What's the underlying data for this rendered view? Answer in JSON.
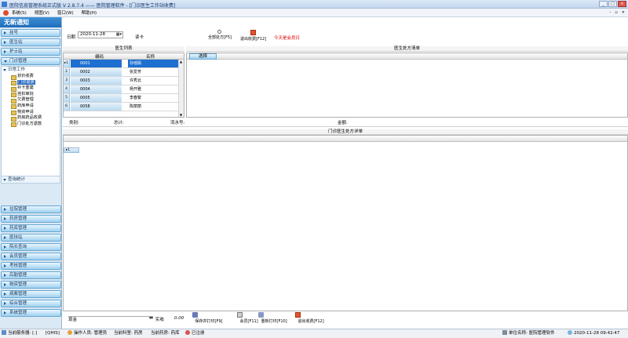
{
  "window": {
    "title": "医院信息管理系统正式版 V 2.8.7.4 —— 医院管理软件 - [门诊医生工作站收费]",
    "btn_min": "_",
    "btn_max": "□",
    "btn_close": "×"
  },
  "menu": {
    "items": [
      "系统(S)",
      "视图(V)",
      "窗口(W)",
      "帮助(H)"
    ],
    "right": [
      "-",
      "▫",
      "×"
    ]
  },
  "sidebar": {
    "notice": "无新通知",
    "top_groups": [
      "挂号",
      "医生站",
      "护士站"
    ],
    "open_group": "门诊管理",
    "sub_title": "日常工作",
    "tree": [
      "划价收费",
      "门诊退费",
      "补卡重建",
      "挂扣审批",
      "欠费管理",
      "药库申请",
      "物资申请",
      "药房药品收费",
      "门诊处方退款"
    ],
    "selected_index": 1,
    "stats": "查询统计",
    "bottom_groups": [
      "住院管理",
      "药房管理",
      "药库管理",
      "医技站",
      "院长查询",
      "会员管理",
      "考核管理",
      "后勤管理",
      "物资管理",
      "病案管理",
      "综合管理",
      "系统管理"
    ]
  },
  "toolbar": {
    "date_label": "日期",
    "date_value": "2020-11-28",
    "card_label": "读卡",
    "btn_all_rx": "全部处方[F5]",
    "btn_exit_charge": "退出收费[F12]",
    "today_notice": "今天是会员日"
  },
  "doctor_list": {
    "title": "医生列表",
    "col_code": "编码",
    "col_name": "名称",
    "rows": [
      {
        "n": "1",
        "code": "0001",
        "name": "孙瑶娟"
      },
      {
        "n": "2",
        "code": "0002",
        "name": "张爱芳"
      },
      {
        "n": "3",
        "code": "0003",
        "name": "许秀云"
      },
      {
        "n": "4",
        "code": "0004",
        "name": "杨开雅"
      },
      {
        "n": "5",
        "code": "0005",
        "name": "李春繁"
      },
      {
        "n": "6",
        "code": "0058",
        "name": "陈丽丽"
      }
    ],
    "selected_index": 0,
    "arrow": "▸"
  },
  "prescription": {
    "title": "医生处方清单",
    "select_btn": "选择"
  },
  "info": {
    "category": "类别:",
    "total": "总计:",
    "serial": "流水号:",
    "amount": "金额:"
  },
  "detail": {
    "title": "门诊医生处方详单",
    "row_marker": "▸1"
  },
  "bottom": {
    "label_left": "现金",
    "received_label": "实收",
    "received_value": "0.00",
    "btn_save_print": "保存并打印[F9]",
    "btn_membership": "会员[F11]",
    "btn_reprint": "重新打印[F10]",
    "btn_exit": "退出收费[F12]"
  },
  "status": {
    "service": "当前服务器: [.]",
    "db": "[QHIS]",
    "operator": "操作人员: 管理员",
    "dept": "当前科室: 药房",
    "pharmacy": "当前药房: 药库",
    "login": "已注册",
    "unit": "单位名称: 医院管理软件",
    "time": "2020-11-28 09:42:47"
  },
  "colors": {
    "accent": "#1e6fd0",
    "sidebar_bg": "#dbe9f4",
    "notice_bg": "#1f6dba",
    "alert": "#e00000"
  }
}
